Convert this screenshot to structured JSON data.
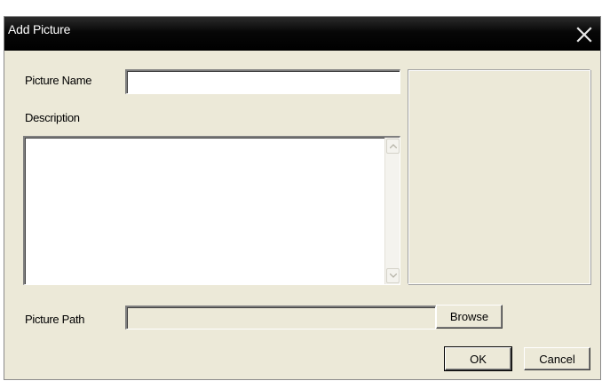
{
  "window": {
    "title": "Add Picture"
  },
  "form": {
    "picture_name_label": "Picture Name",
    "picture_name_value": "",
    "description_label": "Description",
    "description_value": "",
    "picture_path_label": "Picture Path",
    "picture_path_value": ""
  },
  "buttons": {
    "browse": "Browse",
    "ok": "OK",
    "cancel": "Cancel"
  },
  "icons": {
    "close": "close-icon",
    "scroll_up": "chevron-up-icon",
    "scroll_down": "chevron-down-icon"
  },
  "colors": {
    "title_bar": "#000000",
    "dialog_bg": "#ece9d8"
  }
}
